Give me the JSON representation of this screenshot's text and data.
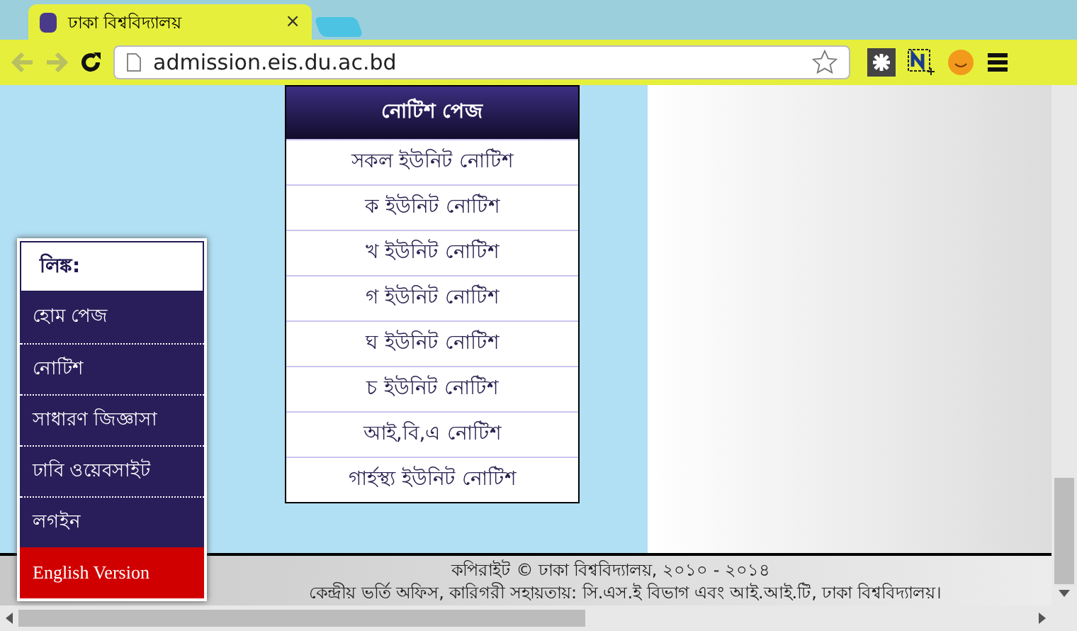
{
  "browser": {
    "tab_title": "ঢাকা  বিশ্ববিদ্যালয়",
    "tab_close": "×",
    "url": "admission.eis.du.ac.bd"
  },
  "notice_panel": {
    "title": "নোটিশ পেজ",
    "items": [
      "সকল ইউনিট নোটিশ",
      "ক ইউনিট নোটিশ",
      "খ ইউনিট নোটিশ",
      "গ ইউনিট নোটিশ",
      "ঘ ইউনিট নোটিশ",
      "চ ইউনিট নোটিশ",
      "আই,বি,এ নোটিশ",
      "গার্হস্থ্য ইউনিট নোটিশ"
    ]
  },
  "links": {
    "title": "লিঙ্ক:",
    "items": [
      {
        "label": "হোম পেজ",
        "kind": "bangla"
      },
      {
        "label": "নোটিশ",
        "kind": "bangla"
      },
      {
        "label": "সাধারণ জিজ্ঞাসা",
        "kind": "bangla"
      },
      {
        "label": "ঢাবি ওয়েবসাইট",
        "kind": "bangla"
      },
      {
        "label": "লগইন",
        "kind": "bangla"
      },
      {
        "label": "English Version",
        "kind": "language"
      }
    ]
  },
  "footer": {
    "copyright": "কপিরাইট © ঢাকা বিশ্ববিদ্যালয়, ২০১০ - ২০১৪",
    "credits": "কেন্দ্রীয় ভর্তি অফিস, কারিগরী সহায়তায়: সি.এস.ই বিভাগ এবং আই.আই.টি, ঢাকা বিশ্ববিদ্যালয়।"
  }
}
